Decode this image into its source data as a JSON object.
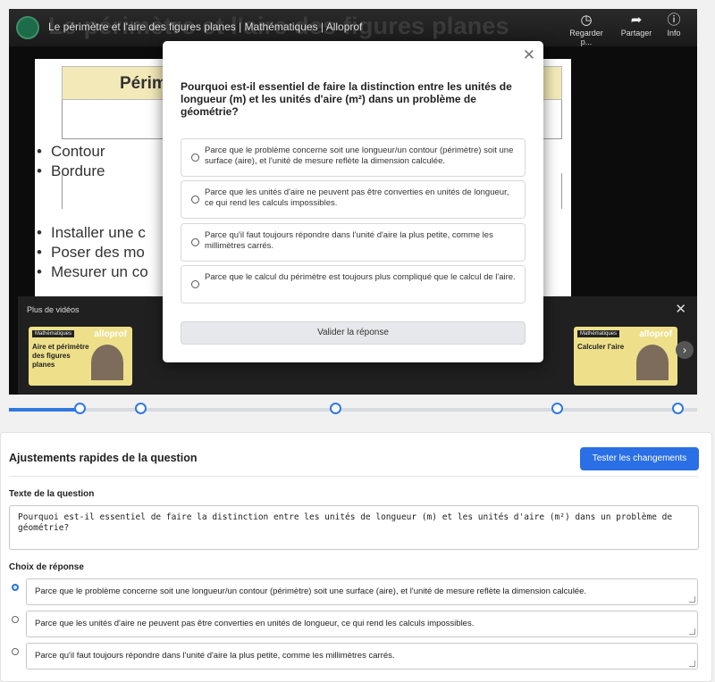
{
  "video": {
    "title_small": "Le périmètre et l'aire des figures planes | Mathématiques | Alloprof",
    "title_big": "Le périmètre et l'aire des figures planes",
    "buttons": {
      "watch_later": "Regarder p...",
      "share": "Partager",
      "info": "Info"
    },
    "slide": {
      "header": "Périmètre",
      "items_a": [
        "Contour",
        "Bordure"
      ],
      "items_b": [
        "Installer une c",
        "Poser des mo",
        "Mesurer un co"
      ]
    },
    "more": {
      "title": "Plus de vidéos",
      "thumbs": [
        {
          "badge": "Mathématiques",
          "title": "Aire et périmètre des figures planes",
          "brand": "alloprof"
        },
        {
          "badge": "Mathématiques",
          "title": "Calculer l'aire",
          "brand": "alloprof"
        }
      ]
    }
  },
  "modal": {
    "question": "Pourquoi est-il essentiel de faire la distinction entre les unités de longueur (m) et les unités d'aire (m²) dans un problème de géométrie?",
    "options": [
      "Parce que le problème concerne soit une longueur/un contour (périmètre) soit une surface (aire), et l'unité de mesure reflète la dimension calculée.",
      "Parce que les unités d'aire ne peuvent pas être converties en unités de longueur, ce qui rend les calculs impossibles.",
      "Parce qu'il faut toujours répondre dans l'unité d'aire la plus petite, comme les millimètres carrés.",
      "Parce que le calcul du périmètre est toujours plus compliqué que le calcul de l'aire."
    ],
    "validate_label": "Valider la réponse"
  },
  "panel": {
    "title": "Ajustements rapides de la question",
    "test_button": "Tester les changements",
    "question_label": "Texte de la question",
    "question_text": "Pourquoi est-il essentiel de faire la distinction entre les unités de longueur (m) et les unités d'aire (m²) dans un problème de géométrie?",
    "choices_label": "Choix de réponse",
    "choices": [
      "Parce que le problème concerne soit une longueur/un contour (périmètre) soit une surface (aire), et l'unité de mesure reflète la dimension calculée.",
      "Parce que les unités d'aire ne peuvent pas être converties en unités de longueur, ce qui rend les calculs impossibles.",
      "Parce qu'il faut toujours répondre dans l'unité d'aire la plus petite, comme les millimètres carrés."
    ],
    "selected_choice": 0
  },
  "colors": {
    "accent": "#2a6fe6",
    "track": "#2f78e0"
  },
  "icons": [
    "clock-icon",
    "share-icon",
    "info-icon",
    "close-icon",
    "chevron-right-icon",
    "radio-icon"
  ]
}
